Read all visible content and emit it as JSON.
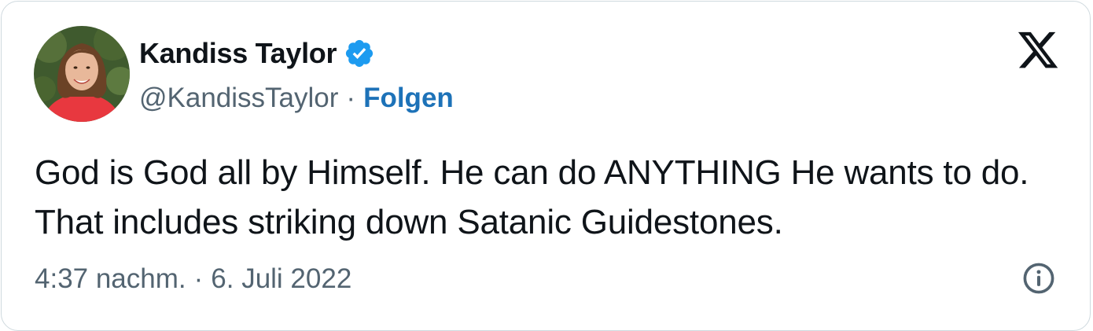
{
  "tweet": {
    "author": {
      "display_name": "Kandiss Taylor",
      "handle": "@KandissTaylor",
      "verified": true,
      "avatar_icon": "profile-photo"
    },
    "separator": "·",
    "follow_label": "Folgen",
    "text": "God is God all by Himself. He can do ANYTHING He wants to do. That includes striking down Satanic Guidestones.",
    "time": "4:37 nachm.",
    "date": "6. Juli 2022",
    "logo_icon": "x-logo-icon",
    "info_icon": "info-icon"
  },
  "colors": {
    "text": "#0f1419",
    "secondary": "#536471",
    "link": "#1d72b8",
    "verified": "#1d9bf0",
    "border": "#cfd9de"
  }
}
